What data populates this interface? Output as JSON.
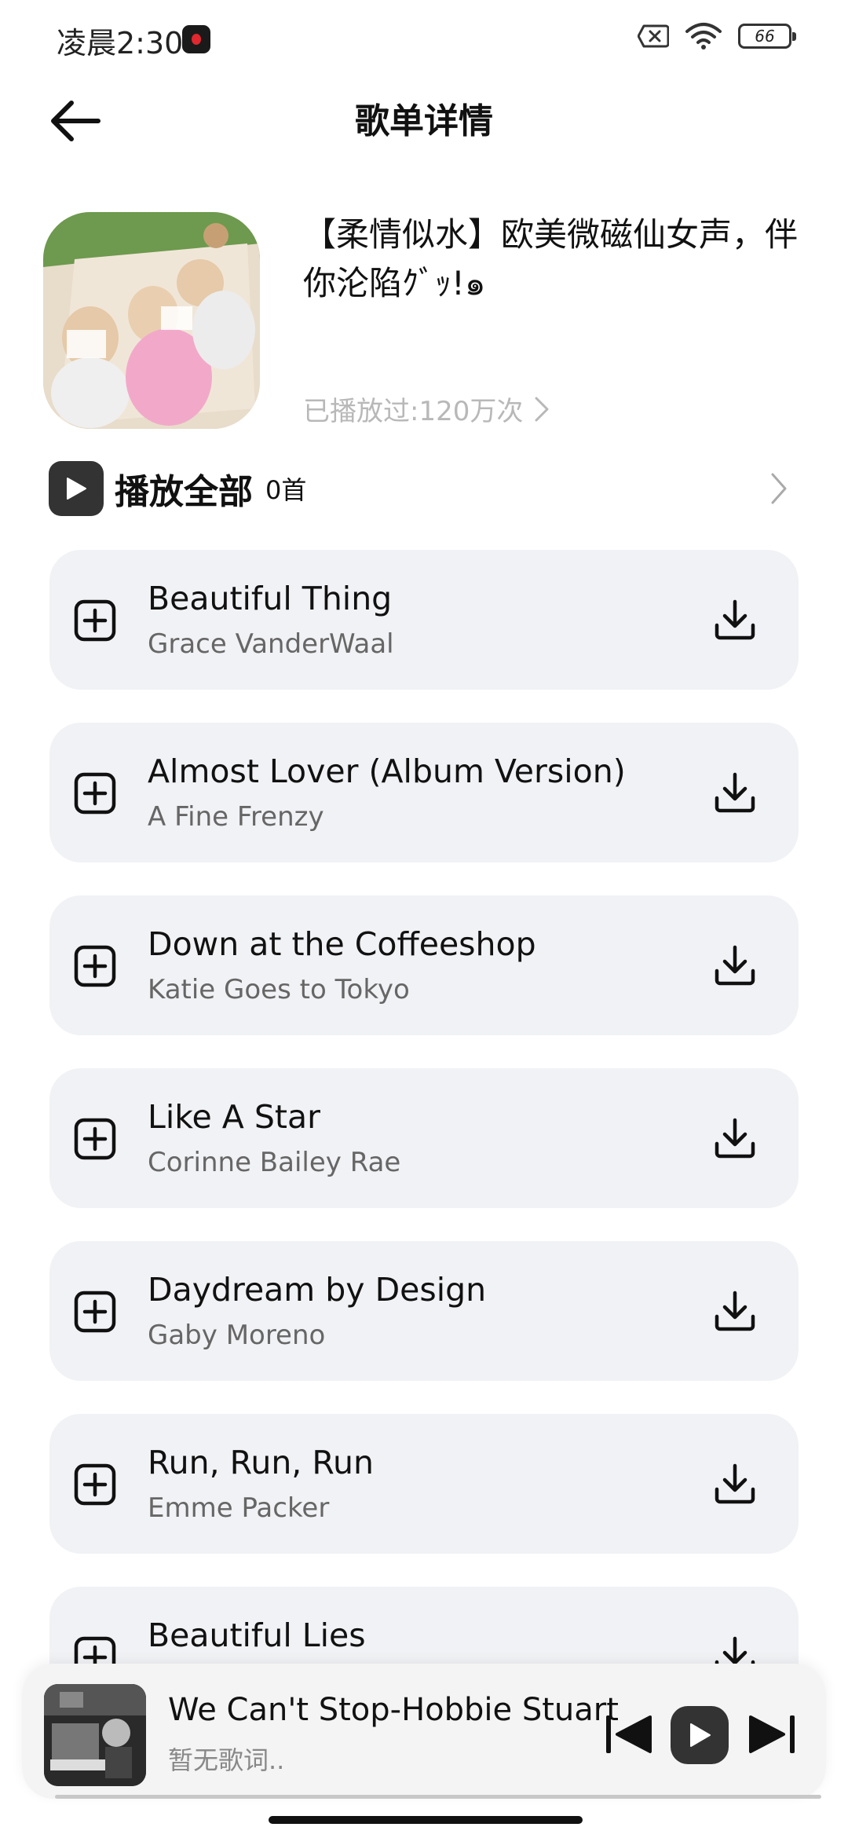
{
  "status_bar": {
    "time": "凌晨2:30",
    "battery": "66"
  },
  "header": {
    "title": "歌单详情"
  },
  "playlist": {
    "title": "【柔情似水】欧美微磁仙女声，伴你沦陷ｸﾞｯ!๑",
    "play_count": "已播放过:120万次"
  },
  "play_all": {
    "label": "播放全部",
    "count": "0首"
  },
  "songs": [
    {
      "title": "Beautiful Thing",
      "artist": "Grace VanderWaal"
    },
    {
      "title": "Almost Lover (Album Version)",
      "artist": "A Fine Frenzy"
    },
    {
      "title": "Down at the Coffeeshop",
      "artist": "Katie Goes to Tokyo"
    },
    {
      "title": "Like A Star",
      "artist": "Corinne Bailey Rae"
    },
    {
      "title": "Daydream by Design",
      "artist": "Gaby Moreno"
    },
    {
      "title": "Run, Run, Run",
      "artist": "Emme Packer"
    },
    {
      "title": "Beautiful Lies",
      "artist": ""
    }
  ],
  "player": {
    "title": "We Can't Stop-Hobbie Stuart",
    "lyric": "暂无歌词.."
  },
  "icons": {
    "back": "arrow-left-icon",
    "add": "plus-square-icon",
    "download": "download-icon",
    "play": "play-icon",
    "prev": "skip-previous-icon",
    "next": "skip-next-icon",
    "chevron": "chevron-right-icon",
    "wifi": "wifi-icon",
    "sim": "no-sim-icon"
  }
}
